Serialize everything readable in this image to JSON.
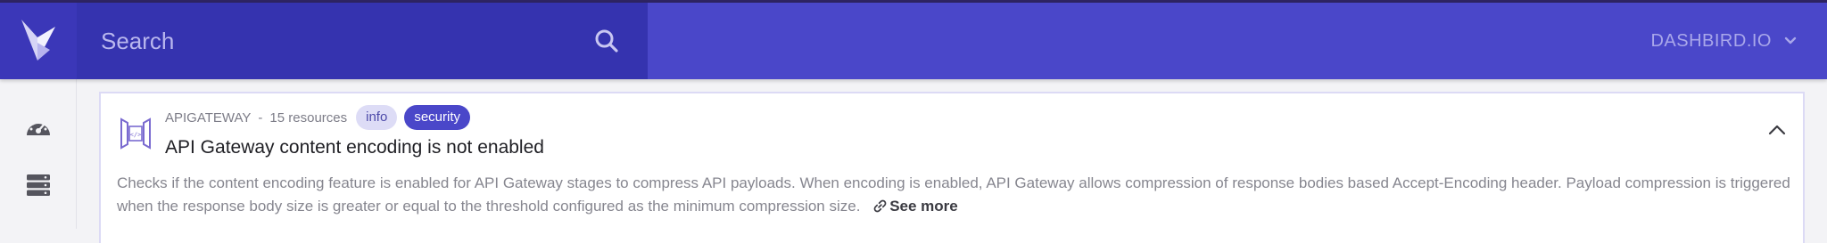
{
  "topbar": {
    "search_placeholder": "Search",
    "account_label": "DASHBIRD.IO"
  },
  "sidebar": {
    "items": [
      {
        "icon": "speedometer-icon"
      },
      {
        "icon": "server-stack-icon"
      }
    ]
  },
  "card": {
    "service": "APIGATEWAY",
    "separator": "-",
    "resources": "15 resources",
    "badges": [
      "info",
      "security"
    ],
    "title": "API Gateway content encoding is not enabled",
    "description": "Checks if the content encoding feature is enabled for API Gateway stages to compress API payloads. When encoding is enabled, API Gateway allows compression of response bodies based Accept-Encoding header. Payload compression is triggered when the response body size is greater or equal to the threshold configured as the minimum compression size.",
    "see_more": "See more"
  },
  "colors": {
    "brand": "#4a47c9",
    "search_bg": "#3533af",
    "badge_info_bg": "#dddcf6"
  }
}
